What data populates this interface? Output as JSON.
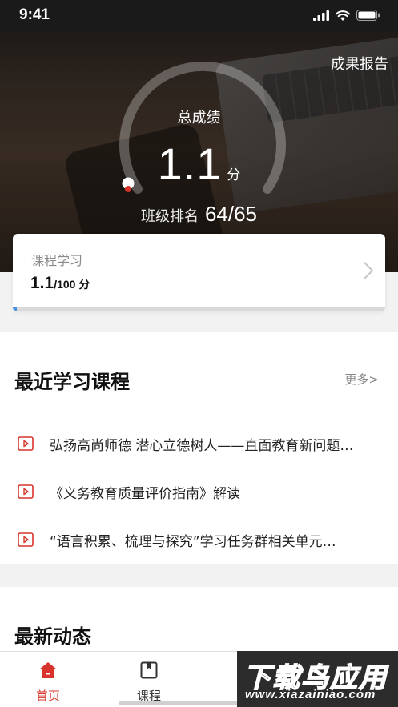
{
  "status_bar": {
    "time": "9:41"
  },
  "hero": {
    "report_link": "成果报告",
    "total_label": "总成绩",
    "score": "1.1",
    "score_unit": "分",
    "rank_label": "班级排名",
    "rank_value": "64/65",
    "gauge_progress": 0.011
  },
  "course_card": {
    "title": "课程学习",
    "score": "1.1",
    "score_suffix": "/100 分",
    "progress": 0.011
  },
  "recent": {
    "title": "最近学习课程",
    "more": "更多>",
    "items": [
      {
        "label": "弘扬高尚师德 潜心立德树人——直面教育新问题…",
        "icon": "video-lesson-icon"
      },
      {
        "label": "《义务教育质量评价指南》解读",
        "icon": "video-lesson-icon"
      },
      {
        "label": "“语言积累、梳理与探究”学习任务群相关单元…",
        "icon": "video-lesson-icon"
      }
    ]
  },
  "news": {
    "title": "最新动态"
  },
  "tabbar": {
    "tabs": [
      {
        "label": "首页",
        "icon": "home-icon",
        "active": true
      },
      {
        "label": "课程",
        "icon": "bookmark-book-icon",
        "active": false
      }
    ]
  },
  "watermark": {
    "main": "下载鸟应用",
    "url": "www.xiazainiao.com"
  },
  "colors": {
    "accent_red": "#d9342b",
    "progress_blue": "#4a90e2"
  }
}
